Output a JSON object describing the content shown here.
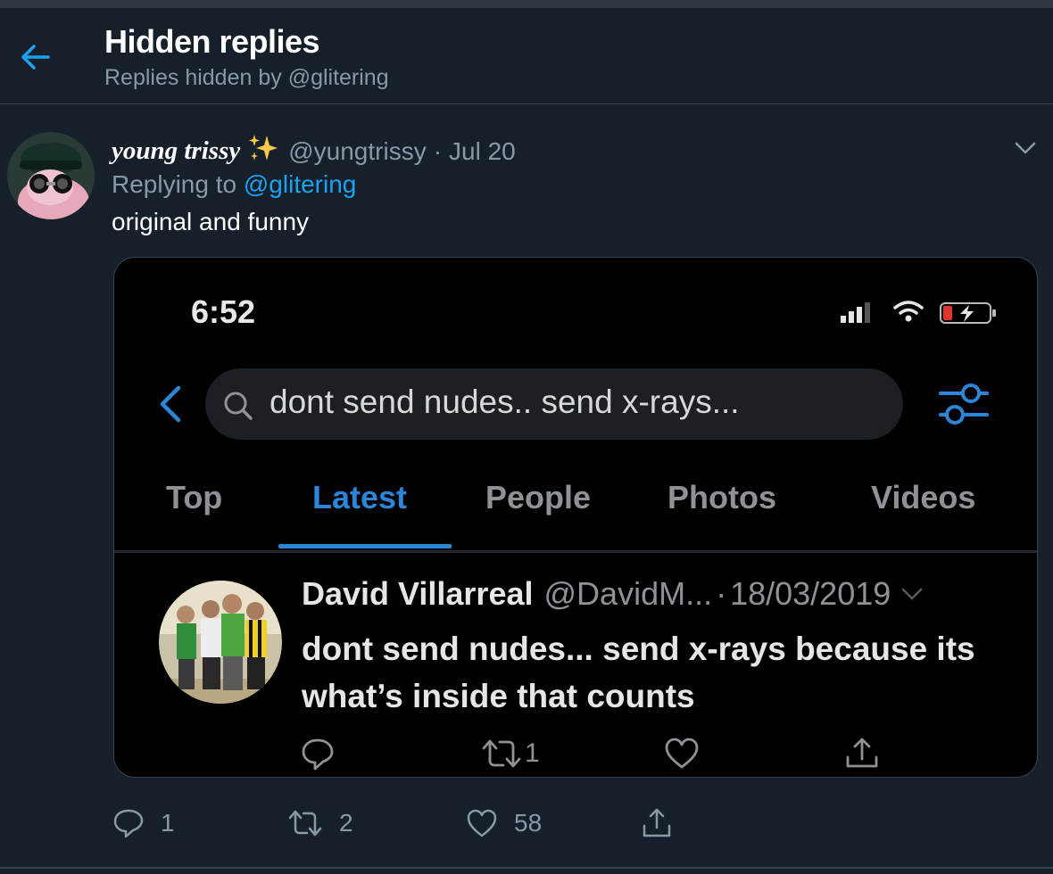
{
  "header": {
    "title": "Hidden replies",
    "subtitle": "Replies hidden by @glitering"
  },
  "tweet": {
    "display_name": "young trissy",
    "sparkle": "✨",
    "handle": "@yungtrissy",
    "separator": "·",
    "date": "Jul 20",
    "replying_prefix": "Replying to",
    "replying_to": "@glitering",
    "text": "original and funny",
    "counts": {
      "reply": "1",
      "retweet": "2",
      "like": "58"
    }
  },
  "media": {
    "time": "6:52",
    "search_text": "dont send nudes.. send x-rays...",
    "tabs": [
      "Top",
      "Latest",
      "People",
      "Photos",
      "Videos"
    ],
    "active_tab": "Latest",
    "inner_tweet": {
      "name": "David Villarreal",
      "handle": "@DavidM...",
      "separator": "·",
      "date": "18/03/2019",
      "text": "dont send nudes... send x-rays because its what’s inside that counts",
      "retweet_count": "1"
    }
  },
  "colors": {
    "background": "#15202b",
    "accent": "#1da1f2",
    "secondary_text": "#8899a6",
    "divider": "#38444d"
  },
  "icons": {
    "back": "arrow-left-icon",
    "caret": "chevron-down-icon",
    "reply": "speech-bubble-icon",
    "retweet": "retweet-icon",
    "like": "heart-icon",
    "share": "share-icon"
  }
}
